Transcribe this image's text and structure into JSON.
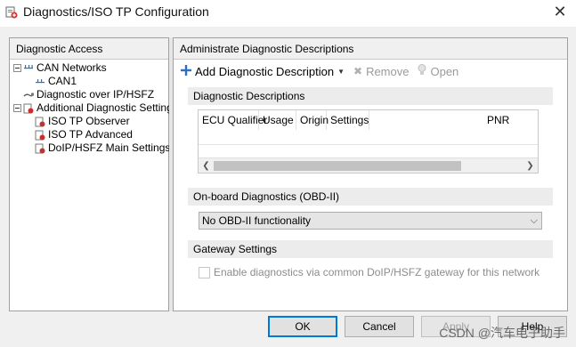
{
  "window": {
    "title": "Diagnostics/ISO TP Configuration"
  },
  "left": {
    "header": "Diagnostic Access",
    "tree": [
      {
        "label": "CAN Networks",
        "icon": "network-icon"
      },
      {
        "label": "CAN1",
        "icon": "bus-icon"
      },
      {
        "label": "Diagnostic over IP/HSFZ",
        "icon": "cable-icon"
      },
      {
        "label": "Additional Diagnostic Settings",
        "icon": "settings-icon"
      },
      {
        "label": "ISO TP Observer",
        "icon": "settings-icon"
      },
      {
        "label": "ISO TP Advanced",
        "icon": "settings-icon"
      },
      {
        "label": "DoIP/HSFZ Main Settings",
        "icon": "settings-icon"
      }
    ]
  },
  "right": {
    "header": "Administrate Diagnostic Descriptions",
    "toolbar": {
      "add": "Add Diagnostic Description",
      "remove": "Remove",
      "open": "Open"
    },
    "desc_section": "Diagnostic Descriptions",
    "columns": [
      "ECU Qualifier",
      "Usage",
      "Origin",
      "Settings",
      "PNR"
    ],
    "obd_section": "On-board Diagnostics (OBD-II)",
    "obd_value": "No OBD-II functionality",
    "gateway_section": "Gateway Settings",
    "gateway_check": "Enable diagnostics via common DoIP/HSFZ gateway for this network"
  },
  "buttons": {
    "ok": "OK",
    "cancel": "Cancel",
    "apply": "Apply",
    "help": "Help"
  },
  "watermark": "CSDN @汽车电子助手",
  "colors": {
    "accent": "#0078d7",
    "add_icon": "#2d6fbe"
  }
}
